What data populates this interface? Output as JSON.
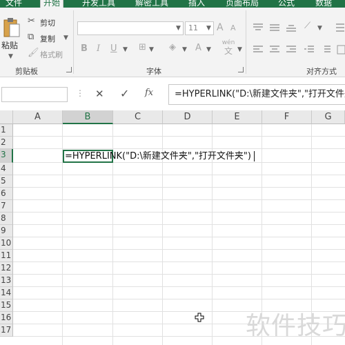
{
  "ribbon_tabs": [
    "文件",
    "开始",
    "开发工具",
    "解密工具",
    "插入",
    "页面布局",
    "公式",
    "数据"
  ],
  "clipboard": {
    "paste_label": "粘贴",
    "cut_label": "剪切",
    "copy_label": "复制",
    "format_painter_label": "格式刷",
    "group_label": "剪贴板"
  },
  "font": {
    "font_name": "",
    "font_size": "11",
    "bold": "B",
    "italic": "I",
    "underline": "U",
    "grow": "A",
    "shrink": "A",
    "font_color": "A",
    "wen": "wén",
    "wen_char": "文",
    "group_label": "字体"
  },
  "alignment": {
    "group_label": "对齐方式"
  },
  "formula_bar": {
    "name_box": "",
    "cancel": "✕",
    "enter": "✓",
    "fx": "fx",
    "formula": "=HYPERLINK(\"D:\\新建文件夹\",\"打开文件夹\")"
  },
  "sheet": {
    "columns": [
      "A",
      "B",
      "C",
      "D",
      "E",
      "F",
      "G"
    ],
    "selected_column": "B",
    "rows": [
      "1",
      "2",
      "3",
      "4",
      "5",
      "6",
      "7",
      "8",
      "9",
      "10",
      "11",
      "12",
      "13",
      "14",
      "15",
      "16",
      "17"
    ],
    "selected_row": "3",
    "active_cell_text": "=HYPERLINK(\"D:\\新建文件夹\",\"打开文件夹\")"
  },
  "watermark": "软件技巧",
  "colors": {
    "accent": "#217346",
    "ribbon_bg": "#f3f3f3",
    "header_bg": "#e9e9e9"
  }
}
